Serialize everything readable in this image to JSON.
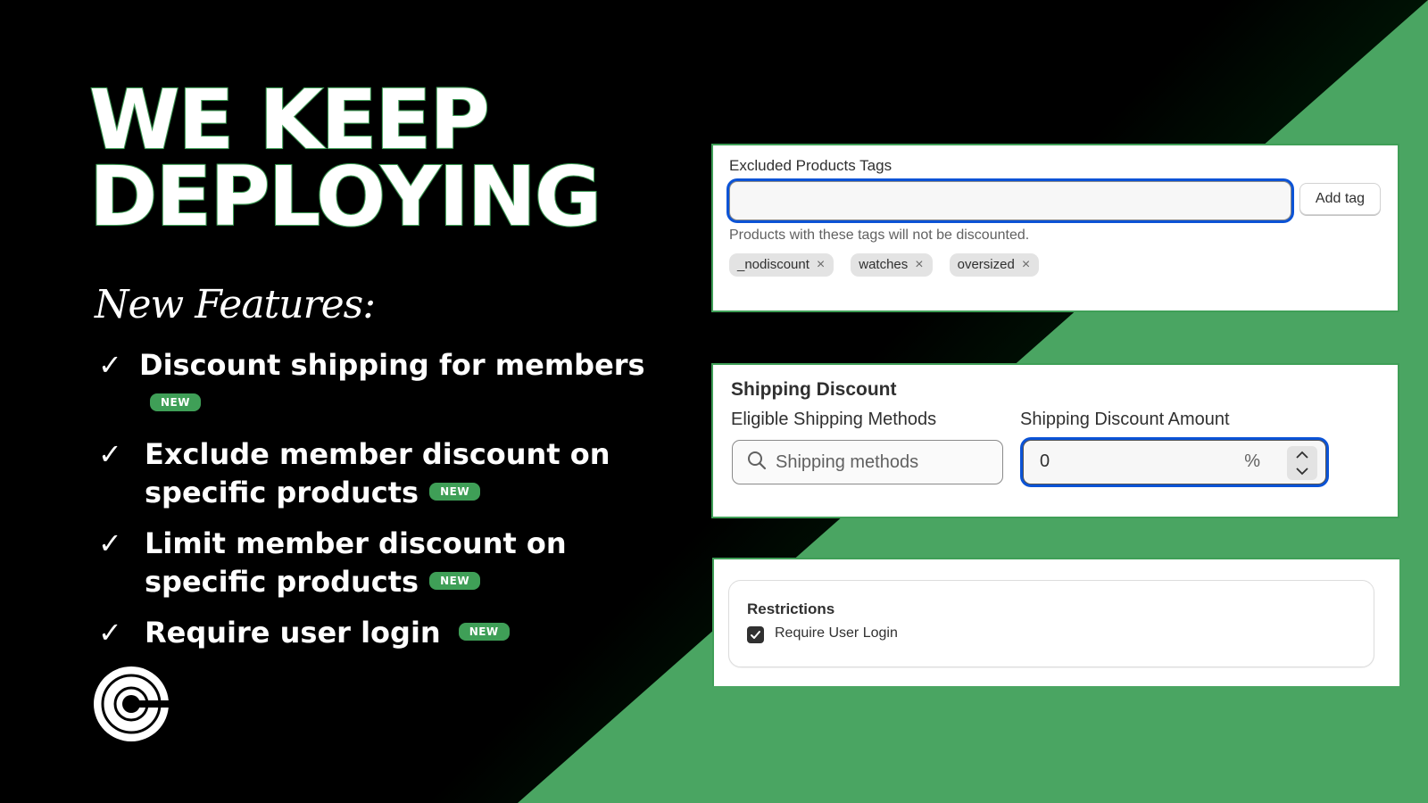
{
  "headline": {
    "line1": "WE KEEP",
    "line2": "DEPLOYING"
  },
  "subhead": "New Features:",
  "features": [
    {
      "check": "✓",
      "line1": "Discount shipping for members",
      "line2": "",
      "badge": "NEW"
    },
    {
      "check": "✓",
      "line1": "Exclude member discount on",
      "line2": "specific products",
      "badge": "NEW"
    },
    {
      "check": "✓",
      "line1": "Limit member discount on",
      "line2": "specific products",
      "badge": "NEW"
    },
    {
      "check": "✓",
      "line1": "Require user login",
      "line2": "",
      "badge": "NEW"
    }
  ],
  "logo": {
    "icon": "concentric-c-logo-icon"
  },
  "excluded_tags_panel": {
    "label": "Excluded Products Tags",
    "input_value": "",
    "add_button": "Add tag",
    "help_text": "Products with these tags will not be discounted.",
    "tags": [
      "_nodiscount",
      "watches",
      "oversized"
    ],
    "remove_icon": "×"
  },
  "shipping_panel": {
    "title": "Shipping Discount",
    "methods_label": "Eligible Shipping Methods",
    "methods_placeholder": "Shipping methods",
    "amount_label": "Shipping Discount Amount",
    "amount_value": "0",
    "amount_suffix": "%"
  },
  "restrictions_panel": {
    "title": "Restrictions",
    "checkbox_label": "Require User Login",
    "checked": true
  },
  "colors": {
    "brand_green": "#4aa562",
    "focus_blue": "#0b53d6",
    "background": "#000000"
  }
}
